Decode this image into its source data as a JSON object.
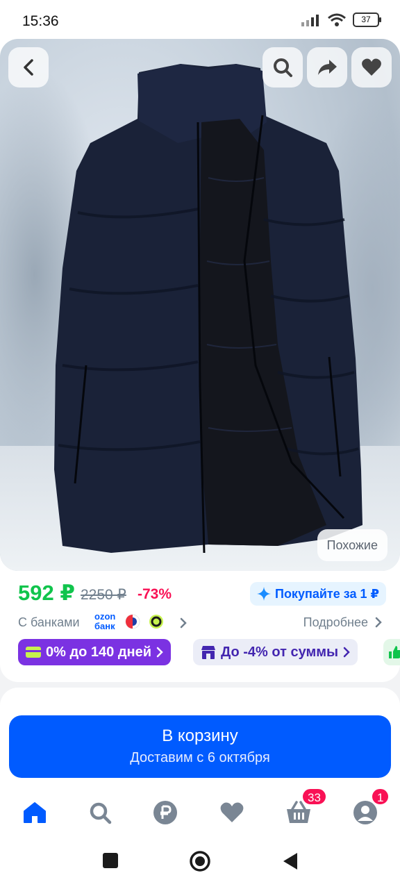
{
  "status_bar": {
    "time": "15:36",
    "battery": "37"
  },
  "product": {
    "similar_label": "Похожие",
    "price": {
      "current": "592 ₽",
      "old": "2250 ₽",
      "discount": "-73%",
      "promo": "Покупайте за 1 ₽"
    },
    "banks": {
      "label": "С банками",
      "ozon_line1": "ozon",
      "ozon_line2": "банк",
      "more": "Подробнее"
    },
    "chips": {
      "installment": "0% до 140 дней",
      "discount": "До -4% от суммы"
    }
  },
  "cart": {
    "title": "В корзину",
    "subtitle": "Доставим с 6 октября"
  },
  "bottom_nav": {
    "cart_badge": "33",
    "profile_badge": "1",
    "items": [
      "home-icon",
      "search-icon",
      "ruble-icon",
      "heart-icon",
      "basket-icon",
      "profile-icon"
    ]
  },
  "colors": {
    "accent": "#005bff",
    "price": "#10c44c",
    "discount": "#f91155",
    "installment_chip": "#7b32e2",
    "vest": "#1a2238"
  }
}
